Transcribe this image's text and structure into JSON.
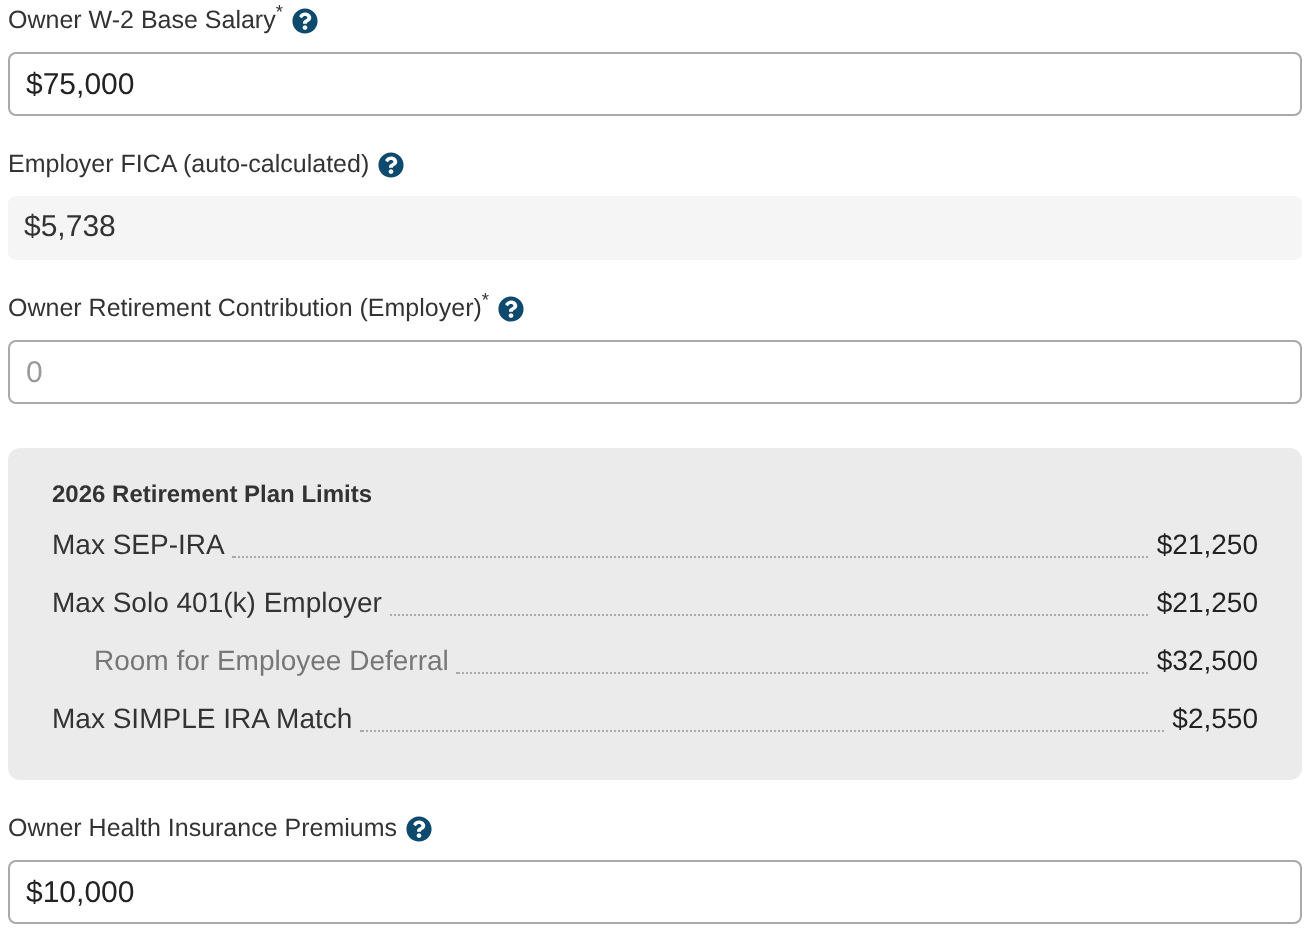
{
  "fields_top": [
    {
      "kind": "input",
      "label": "Owner W-2 Base Salary$^{*}$",
      "help": true,
      "value": "$75,000"
    },
    {
      "kind": "readonly",
      "label": "Employer FICA (auto-calculated)",
      "help": true,
      "value": "$5,738"
    },
    {
      "kind": "input",
      "label": "Owner Retirement Contribution (Employer)$^{*}$",
      "help": true,
      "placeholder": "0"
    }
  ],
  "limits": {
    "title": "2026 Retirement Plan Limits",
    "rows": [
      {
        "label": "Max SEP-IRA",
        "value": "$21,250",
        "indented": false
      },
      {
        "label": "Max Solo 401(k) Employer",
        "value": "$21,250",
        "indented": false
      },
      {
        "label": "Room for Employee Deferral",
        "value": "$32,500",
        "indented": true
      },
      {
        "label": "Max SIMPLE IRA Match",
        "value": "$2,550",
        "indented": false
      }
    ]
  },
  "fields_bottom": [
    {
      "kind": "input",
      "label": "Owner Health Insurance Premiums",
      "help": true,
      "value": "$10,000"
    }
  ]
}
